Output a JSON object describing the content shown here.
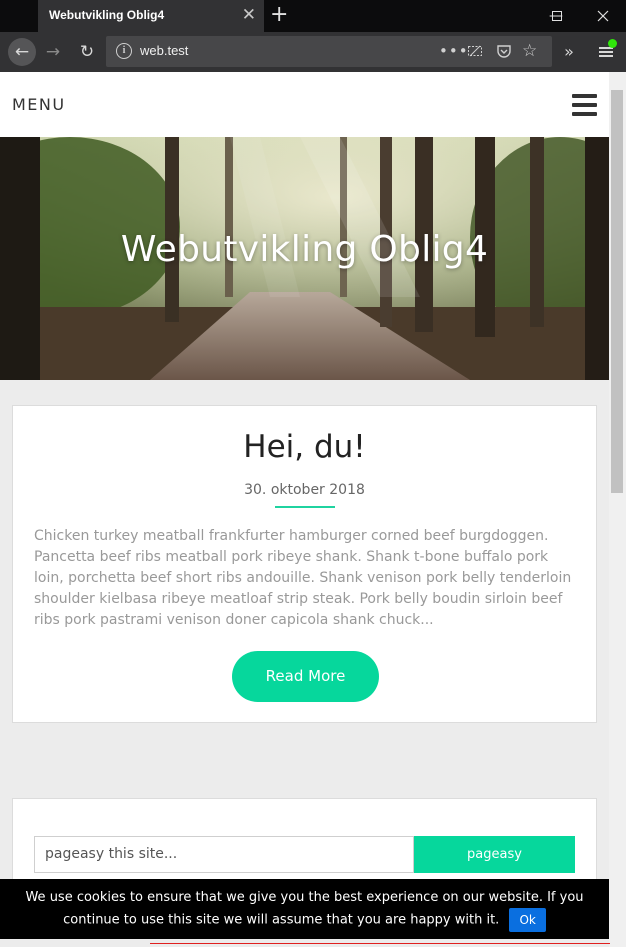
{
  "browser": {
    "tab_title": "Webutvikling Oblig4",
    "tab_close_icon": "close-icon",
    "new_tab_icon": "plus-icon",
    "url": "web.test",
    "window_controls": [
      "minimize-icon",
      "maximize-icon",
      "close-icon"
    ]
  },
  "site": {
    "menu_label": "MENU",
    "hero_title": "Webutvikling Oblig4"
  },
  "post": {
    "title": "Hei, du!",
    "date": "30. oktober 2018",
    "excerpt": "Chicken turkey meatball frankfurter hamburger corned beef burgdoggen. Pancetta beef ribs meatball pork ribeye shank. Shank t-bone buffalo pork loin, porchetta beef short ribs andouille. Shank venison pork belly tenderloin shoulder kielbasa ribeye meatloaf strip steak. Pork belly boudin sirloin beef ribs pork pastrami venison doner capicola shank chuck...",
    "read_more": "Read More"
  },
  "search": {
    "placeholder": "pageasy this site...",
    "button": "pageasy"
  },
  "cookie": {
    "text": "We use cookies to ensure that we give you the best experience on our website. If you continue to use this site we will assume that you are happy with it.",
    "ok": "Ok"
  },
  "colors": {
    "accent": "#06d79c",
    "cookie_button": "#0a6fe0",
    "browser_chrome": "#323234"
  }
}
